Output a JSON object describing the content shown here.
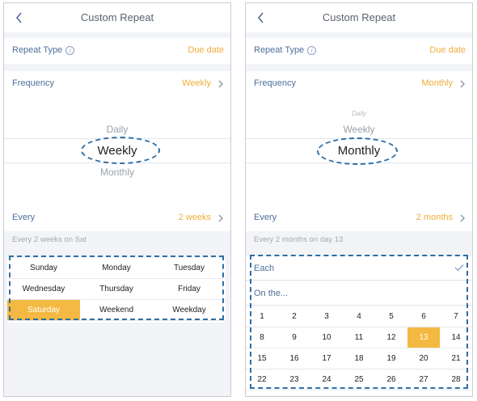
{
  "colors": {
    "accent": "#f0ad3c",
    "highlight": "#f4b942",
    "annotation": "#2f6da3",
    "label": "#4f6f9a"
  },
  "left": {
    "title": "Custom Repeat",
    "repeat_type_label": "Repeat Type",
    "repeat_type_value": "Due date",
    "frequency_label": "Frequency",
    "frequency_value": "Weekly",
    "picker": {
      "above": "Daily",
      "selected": "Weekly",
      "below": "Monthly"
    },
    "every_label": "Every",
    "every_value": "2 weeks",
    "hint": "Every 2 weeks on Sat",
    "days": [
      [
        "Sunday",
        "Monday",
        "Tuesday"
      ],
      [
        "Wednesday",
        "Thursday",
        "Friday"
      ],
      [
        "Saturday",
        "Weekend",
        "Weekday"
      ]
    ],
    "selected_day": "Saturday"
  },
  "right": {
    "title": "Custom Repeat",
    "repeat_type_label": "Repeat Type",
    "repeat_type_value": "Due date",
    "frequency_label": "Frequency",
    "frequency_value": "Monthly",
    "picker": {
      "above2": "Daily",
      "above": "Weekly",
      "selected": "Monthly"
    },
    "every_label": "Every",
    "every_value": "2 months",
    "hint": "Every 2 months on day 13",
    "each_label": "Each",
    "on_the_label": "On the...",
    "calendar": [
      [
        "1",
        "2",
        "3",
        "4",
        "5",
        "6",
        "7"
      ],
      [
        "8",
        "9",
        "10",
        "11",
        "12",
        "13",
        "14"
      ],
      [
        "15",
        "16",
        "17",
        "18",
        "19",
        "20",
        "21"
      ],
      [
        "22",
        "23",
        "24",
        "25",
        "26",
        "27",
        "28"
      ]
    ],
    "selected_date": "13"
  }
}
